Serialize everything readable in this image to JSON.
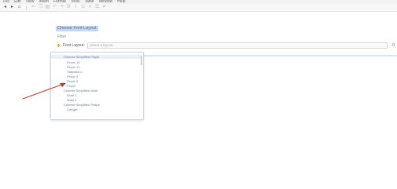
{
  "menu": [
    "File",
    "Edit",
    "View",
    "Insert",
    "Format",
    "Tools",
    "Table",
    "Window",
    "Help"
  ],
  "toolbar": {
    "icons": [
      "back-icon",
      "forward-icon",
      "home-icon",
      "cut-icon",
      "copy-icon",
      "paste-icon",
      "undo-icon",
      "redo-icon",
      "bold-icon",
      "italic-icon",
      "underline-icon",
      "align-icon",
      "list-icon",
      "link-icon"
    ]
  },
  "section": {
    "title": "Choose Font Layout",
    "filter_label": "Filter",
    "field_label": "Font Layout:",
    "input_placeholder": "Select a layout...",
    "end_char": "0"
  },
  "dropdown": {
    "options": [
      {
        "text": "Chinese Simplified Pinyin",
        "kind": "group"
      },
      {
        "text": "Pinyin 14",
        "kind": "item"
      },
      {
        "text": "Pinyin 17",
        "kind": "item"
      },
      {
        "text": "Standard 2",
        "kind": "item"
      },
      {
        "text": "Pinyin 3",
        "kind": "item"
      },
      {
        "text": "Pinyin 2",
        "kind": "item"
      },
      {
        "text": "Pinyin",
        "kind": "item"
      },
      {
        "text": "Chinese Simplified Wubi",
        "kind": "group"
      },
      {
        "text": "Wubi 1",
        "kind": "item"
      },
      {
        "text": "Wubi 2",
        "kind": "item"
      },
      {
        "text": "Chinese Simplified Shape",
        "kind": "group"
      },
      {
        "text": "Cangjie",
        "kind": "item"
      }
    ]
  },
  "colors": {
    "annotation_arrow": "#d93025",
    "selection_bg": "#c5d8f2",
    "option_text": "#6a7d96"
  }
}
